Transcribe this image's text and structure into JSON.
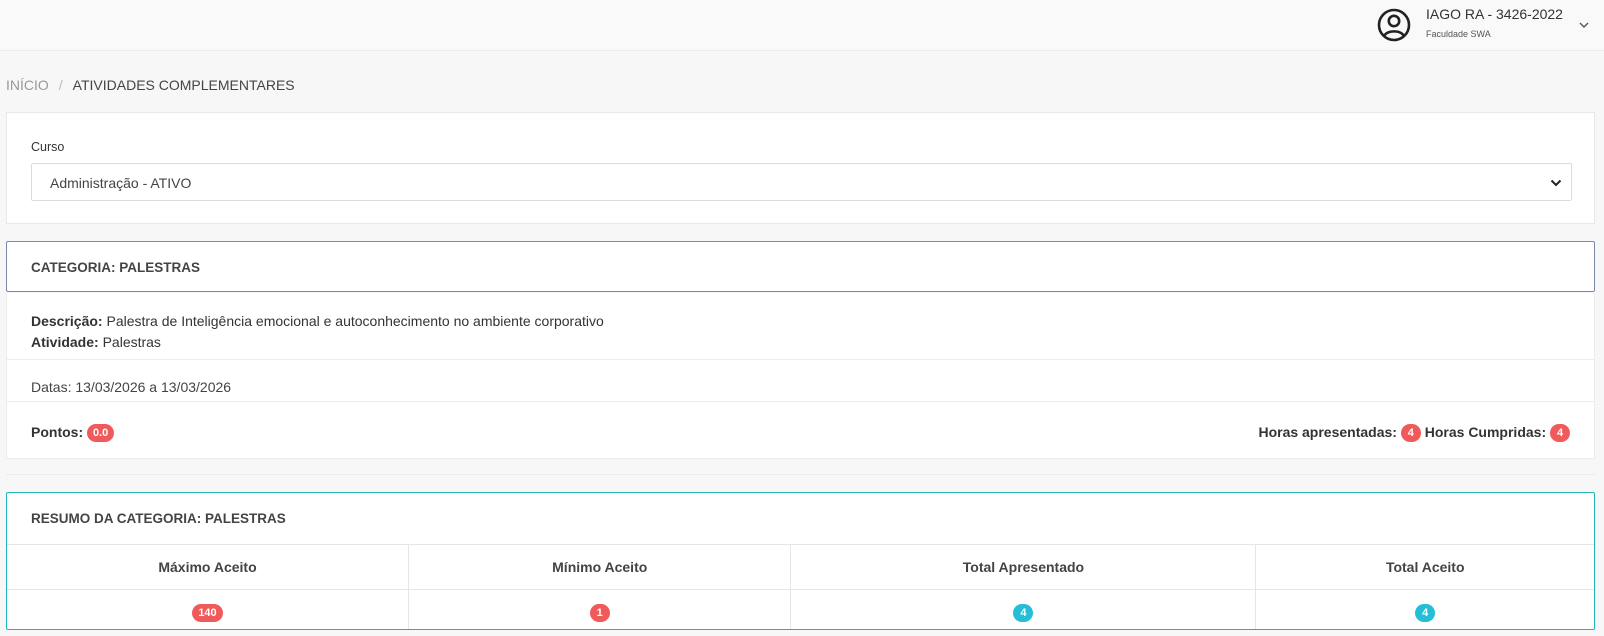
{
  "header": {
    "user_name": "IAGO RA - 3426-2022",
    "institution": "Faculdade SWA"
  },
  "breadcrumb": {
    "home": "INÍCIO",
    "separator": "/",
    "current": "ATIVIDADES COMPLEMENTARES"
  },
  "curso": {
    "label": "Curso",
    "selected": "Administração - ATIVO"
  },
  "categoria": {
    "title": "CATEGORIA: PALESTRAS",
    "descricao_label": "Descrição:",
    "descricao_value": "Palestra de Inteligência emocional e autoconhecimento no ambiente corporativo",
    "atividade_label": "Atividade:",
    "atividade_value": "Palestras",
    "datas": "Datas: 13/03/2026 a 13/03/2026",
    "pontos_label": "Pontos:",
    "pontos_value": "0.0",
    "horas_apresentadas_label": "Horas apresentadas:",
    "horas_apresentadas_value": "4",
    "horas_cumpridas_label": "Horas Cumpridas:",
    "horas_cumpridas_value": "4"
  },
  "resumo": {
    "title": "RESUMO DA CATEGORIA: PALESTRAS",
    "columns": [
      "Máximo Aceito",
      "Mínimo Aceito",
      "Total Apresentado",
      "Total Aceito"
    ],
    "values": [
      "140",
      "1",
      "4",
      "4"
    ]
  },
  "colors": {
    "badge_red": "#f05a5b",
    "badge_cyan": "#24bfd6",
    "categoria_border": "#7b89aa",
    "resumo_border": "#20b5b5"
  },
  "icons": {
    "user": "user-circle-icon",
    "chevron": "chevron-down-icon",
    "select_caret": "chevron-down-icon"
  }
}
